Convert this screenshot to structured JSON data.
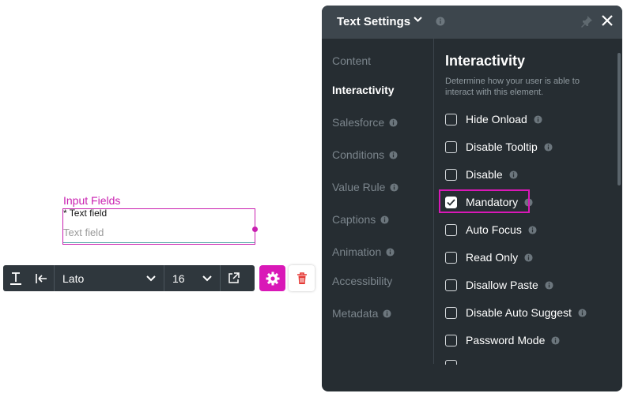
{
  "canvas": {
    "group_label": "Input Fields",
    "field_label": "* Text field",
    "field_placeholder": "Text field"
  },
  "toolbar": {
    "font": "Lato",
    "font_size": "16"
  },
  "panel": {
    "title": "Text Settings",
    "nav": [
      {
        "label": "Content",
        "active": false,
        "info": false
      },
      {
        "label": "Interactivity",
        "active": true,
        "info": false
      },
      {
        "label": "Salesforce",
        "active": false,
        "info": true
      },
      {
        "label": "Conditions",
        "active": false,
        "info": true
      },
      {
        "label": "Value Rule",
        "active": false,
        "info": true
      },
      {
        "label": "Captions",
        "active": false,
        "info": true
      },
      {
        "label": "Animation",
        "active": false,
        "info": true
      },
      {
        "label": "Accessibility",
        "active": false,
        "info": false
      },
      {
        "label": "Metadata",
        "active": false,
        "info": true
      }
    ],
    "section_title": "Interactivity",
    "section_desc": "Determine how your user is able to interact with this element.",
    "options": [
      {
        "label": "Hide Onload",
        "checked": false
      },
      {
        "label": "Disable Tooltip",
        "checked": false
      },
      {
        "label": "Disable",
        "checked": false
      },
      {
        "label": "Mandatory",
        "checked": true
      },
      {
        "label": "Auto Focus",
        "checked": false
      },
      {
        "label": "Read Only",
        "checked": false
      },
      {
        "label": "Disallow Paste",
        "checked": false
      },
      {
        "label": "Disable Auto Suggest",
        "checked": false
      },
      {
        "label": "Password Mode",
        "checked": false
      }
    ]
  },
  "colors": {
    "accent": "#d918b7",
    "panel_bg": "#262d32",
    "panel_header": "#3d464d"
  }
}
